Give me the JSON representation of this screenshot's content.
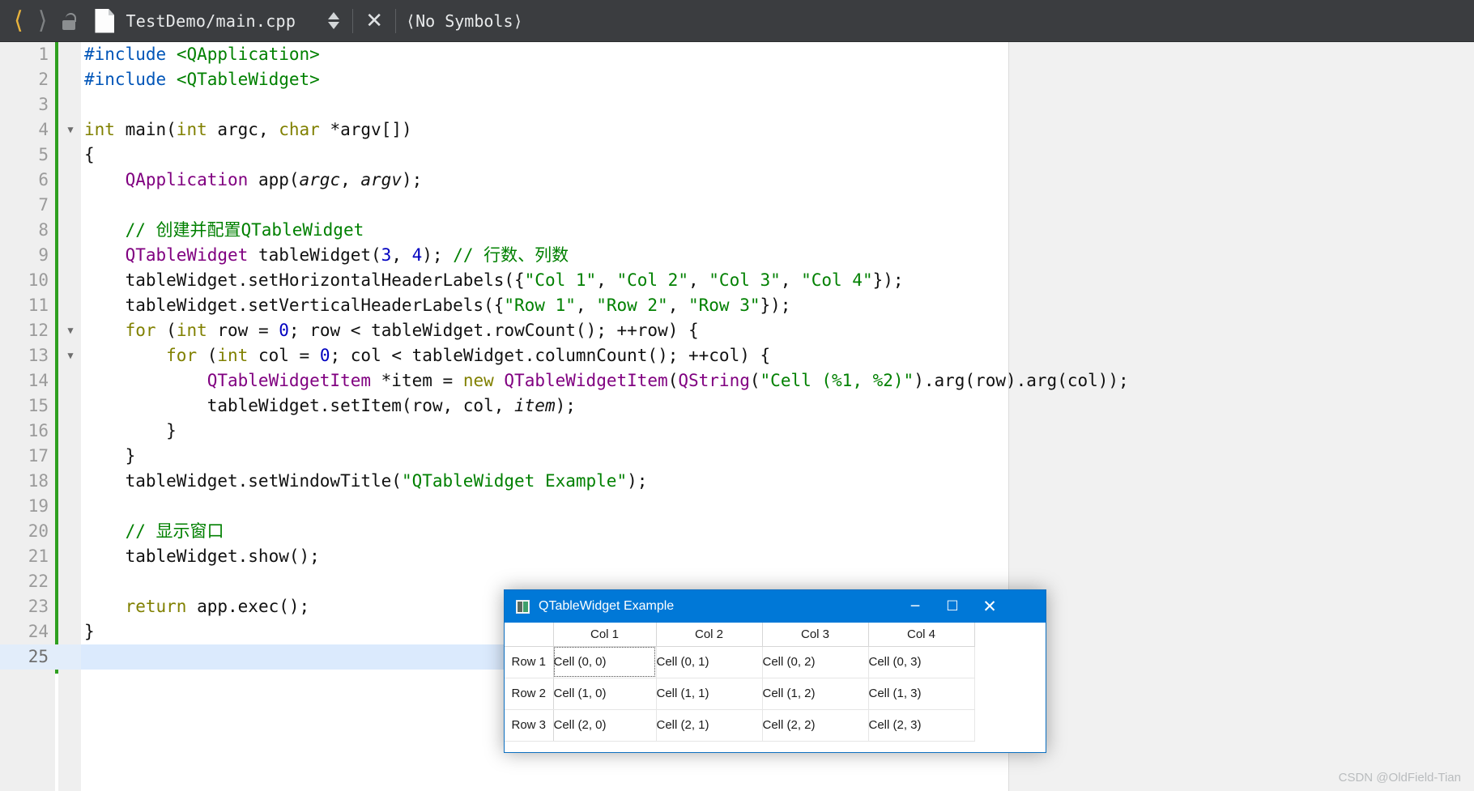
{
  "toolbar": {
    "back_icon": "chevron-left-icon",
    "forward_icon": "chevron-right-icon",
    "lock_icon": "unlocked-padlock-icon",
    "file_icon": "document-icon",
    "file_path": "TestDemo/main.cpp",
    "stepper_icon": "updown-stepper-icon",
    "close_label": "✕",
    "symbols_label": "⟨No Symbols⟩"
  },
  "editor": {
    "language": "cpp",
    "total_lines": 25,
    "current_line": 25,
    "colors": {
      "keyword": "#808000",
      "class": "#800080",
      "string": "#008000",
      "comment": "#008000",
      "number": "#0000c0",
      "preprocessor": "#0055b8",
      "gutter_bg": "#efefef",
      "modified_bar": "#2fa01f",
      "current_line_bg": "#dbeafd"
    },
    "lines": [
      {
        "n": 1,
        "fold": "",
        "tokens": [
          {
            "t": "#include",
            "c": "pp"
          },
          {
            "t": " ",
            "c": ""
          },
          {
            "t": "<QApplication>",
            "c": "inc"
          }
        ]
      },
      {
        "n": 2,
        "fold": "",
        "tokens": [
          {
            "t": "#include",
            "c": "pp"
          },
          {
            "t": " ",
            "c": ""
          },
          {
            "t": "<QTableWidget>",
            "c": "inc"
          }
        ]
      },
      {
        "n": 3,
        "fold": "",
        "tokens": []
      },
      {
        "n": 4,
        "fold": "▼",
        "tokens": [
          {
            "t": "int",
            "c": "k"
          },
          {
            "t": " main(",
            "c": ""
          },
          {
            "t": "int",
            "c": "k"
          },
          {
            "t": " argc, ",
            "c": ""
          },
          {
            "t": "char",
            "c": "k"
          },
          {
            "t": " *argv[])",
            "c": ""
          }
        ]
      },
      {
        "n": 5,
        "fold": "",
        "tokens": [
          {
            "t": "{",
            "c": ""
          }
        ]
      },
      {
        "n": 6,
        "fold": "",
        "tokens": [
          {
            "t": "    ",
            "c": ""
          },
          {
            "t": "QApplication",
            "c": "cls"
          },
          {
            "t": " app(",
            "c": ""
          },
          {
            "t": "argc",
            "c": "par"
          },
          {
            "t": ", ",
            "c": ""
          },
          {
            "t": "argv",
            "c": "par"
          },
          {
            "t": ");",
            "c": ""
          }
        ]
      },
      {
        "n": 7,
        "fold": "",
        "tokens": []
      },
      {
        "n": 8,
        "fold": "",
        "tokens": [
          {
            "t": "    ",
            "c": ""
          },
          {
            "t": "// 创建并配置QTableWidget",
            "c": "cmt"
          }
        ]
      },
      {
        "n": 9,
        "fold": "",
        "tokens": [
          {
            "t": "    ",
            "c": ""
          },
          {
            "t": "QTableWidget",
            "c": "cls"
          },
          {
            "t": " tableWidget(",
            "c": ""
          },
          {
            "t": "3",
            "c": "num"
          },
          {
            "t": ", ",
            "c": ""
          },
          {
            "t": "4",
            "c": "num"
          },
          {
            "t": "); ",
            "c": ""
          },
          {
            "t": "// 行数、列数",
            "c": "cmt"
          }
        ]
      },
      {
        "n": 10,
        "fold": "",
        "tokens": [
          {
            "t": "    tableWidget.setHorizontalHeaderLabels({",
            "c": ""
          },
          {
            "t": "\"Col 1\"",
            "c": "str"
          },
          {
            "t": ", ",
            "c": ""
          },
          {
            "t": "\"Col 2\"",
            "c": "str"
          },
          {
            "t": ", ",
            "c": ""
          },
          {
            "t": "\"Col 3\"",
            "c": "str"
          },
          {
            "t": ", ",
            "c": ""
          },
          {
            "t": "\"Col 4\"",
            "c": "str"
          },
          {
            "t": "});",
            "c": ""
          }
        ]
      },
      {
        "n": 11,
        "fold": "",
        "tokens": [
          {
            "t": "    tableWidget.setVerticalHeaderLabels({",
            "c": ""
          },
          {
            "t": "\"Row 1\"",
            "c": "str"
          },
          {
            "t": ", ",
            "c": ""
          },
          {
            "t": "\"Row 2\"",
            "c": "str"
          },
          {
            "t": ", ",
            "c": ""
          },
          {
            "t": "\"Row 3\"",
            "c": "str"
          },
          {
            "t": "});",
            "c": ""
          }
        ]
      },
      {
        "n": 12,
        "fold": "▼",
        "tokens": [
          {
            "t": "    ",
            "c": ""
          },
          {
            "t": "for",
            "c": "k"
          },
          {
            "t": " (",
            "c": ""
          },
          {
            "t": "int",
            "c": "k"
          },
          {
            "t": " row = ",
            "c": ""
          },
          {
            "t": "0",
            "c": "num"
          },
          {
            "t": "; row < tableWidget.rowCount(); ++row) {",
            "c": ""
          }
        ]
      },
      {
        "n": 13,
        "fold": "▼",
        "tokens": [
          {
            "t": "        ",
            "c": ""
          },
          {
            "t": "for",
            "c": "k"
          },
          {
            "t": " (",
            "c": ""
          },
          {
            "t": "int",
            "c": "k"
          },
          {
            "t": " col = ",
            "c": ""
          },
          {
            "t": "0",
            "c": "num"
          },
          {
            "t": "; col < tableWidget.columnCount(); ++col) {",
            "c": ""
          }
        ]
      },
      {
        "n": 14,
        "fold": "",
        "tokens": [
          {
            "t": "            ",
            "c": ""
          },
          {
            "t": "QTableWidgetItem",
            "c": "cls"
          },
          {
            "t": " *item = ",
            "c": ""
          },
          {
            "t": "new",
            "c": "k"
          },
          {
            "t": " ",
            "c": ""
          },
          {
            "t": "QTableWidgetItem",
            "c": "cls"
          },
          {
            "t": "(",
            "c": ""
          },
          {
            "t": "QString",
            "c": "cls"
          },
          {
            "t": "(",
            "c": ""
          },
          {
            "t": "\"Cell (%1, %2)\"",
            "c": "str"
          },
          {
            "t": ").arg(row).arg(col));",
            "c": ""
          }
        ]
      },
      {
        "n": 15,
        "fold": "",
        "tokens": [
          {
            "t": "            tableWidget.setItem(row, col, ",
            "c": ""
          },
          {
            "t": "item",
            "c": "loc"
          },
          {
            "t": ");",
            "c": ""
          }
        ]
      },
      {
        "n": 16,
        "fold": "",
        "tokens": [
          {
            "t": "        }",
            "c": ""
          }
        ]
      },
      {
        "n": 17,
        "fold": "",
        "tokens": [
          {
            "t": "    }",
            "c": ""
          }
        ]
      },
      {
        "n": 18,
        "fold": "",
        "tokens": [
          {
            "t": "    tableWidget.setWindowTitle(",
            "c": ""
          },
          {
            "t": "\"QTableWidget Example\"",
            "c": "str"
          },
          {
            "t": ");",
            "c": ""
          }
        ]
      },
      {
        "n": 19,
        "fold": "",
        "tokens": []
      },
      {
        "n": 20,
        "fold": "",
        "tokens": [
          {
            "t": "    ",
            "c": ""
          },
          {
            "t": "// 显示窗口",
            "c": "cmt"
          }
        ]
      },
      {
        "n": 21,
        "fold": "",
        "tokens": [
          {
            "t": "    tableWidget.show();",
            "c": ""
          }
        ]
      },
      {
        "n": 22,
        "fold": "",
        "tokens": []
      },
      {
        "n": 23,
        "fold": "",
        "tokens": [
          {
            "t": "    ",
            "c": ""
          },
          {
            "t": "return",
            "c": "k"
          },
          {
            "t": " app.exec();",
            "c": ""
          }
        ]
      },
      {
        "n": 24,
        "fold": "",
        "tokens": [
          {
            "t": "}",
            "c": ""
          }
        ]
      },
      {
        "n": 25,
        "fold": "",
        "tokens": []
      }
    ]
  },
  "qt_dialog": {
    "icon": "qt-app-icon",
    "title": "QTableWidget Example",
    "titlebar_color": "#0078d7",
    "minimize_label": "─",
    "maximize_label": "☐",
    "close_label": "✕",
    "table": {
      "corner_label": "",
      "column_headers": [
        "Col 1",
        "Col 2",
        "Col 3",
        "Col 4"
      ],
      "row_headers": [
        "Row 1",
        "Row 2",
        "Row 3"
      ],
      "focused_cell": [
        0,
        0
      ],
      "rows": [
        [
          "Cell (0, 0)",
          "Cell (0, 1)",
          "Cell (0, 2)",
          "Cell (0, 3)"
        ],
        [
          "Cell (1, 0)",
          "Cell (1, 1)",
          "Cell (1, 2)",
          "Cell (1, 3)"
        ],
        [
          "Cell (2, 0)",
          "Cell (2, 1)",
          "Cell (2, 2)",
          "Cell (2, 3)"
        ]
      ]
    }
  },
  "watermark": {
    "text": "CSDN @OldField-Tian"
  }
}
